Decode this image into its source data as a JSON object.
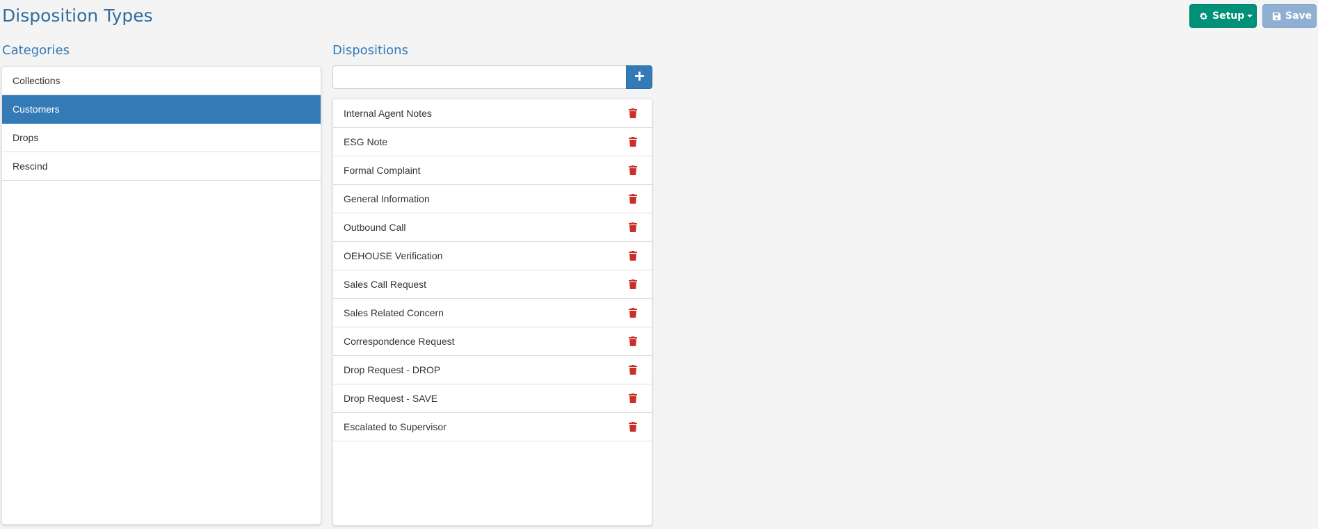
{
  "page": {
    "title": "Disposition Types"
  },
  "toolbar": {
    "setup_label": "Setup",
    "save_label": "Save"
  },
  "categories": {
    "title": "Categories",
    "items": [
      {
        "label": "Collections",
        "active": false
      },
      {
        "label": "Customers",
        "active": true
      },
      {
        "label": "Drops",
        "active": false
      },
      {
        "label": "Rescind",
        "active": false
      }
    ]
  },
  "dispositions": {
    "title": "Dispositions",
    "input_value": "",
    "items": [
      "Internal Agent Notes",
      "ESG Note",
      "Formal Complaint",
      "General Information",
      "Outbound Call",
      "OEHOUSE Verification",
      "Sales Call Request",
      "Sales Related Concern",
      "Correspondence Request",
      "Drop Request - DROP",
      "Drop Request - SAVE",
      "Escalated to Supervisor"
    ]
  },
  "colors": {
    "accent": "#337ab7",
    "setup": "#009179",
    "save": "#8fb0d3",
    "delete": "#c9302c"
  },
  "icons": {
    "setup": "gear-icon",
    "save": "floppy-icon",
    "add": "plus-icon",
    "delete": "trash-icon"
  }
}
